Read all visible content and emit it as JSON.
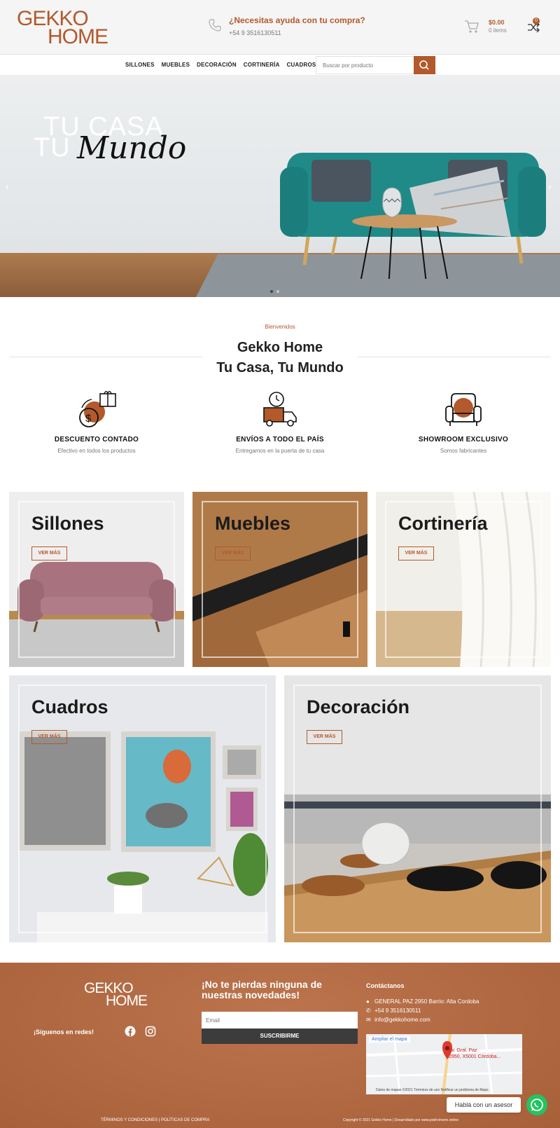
{
  "header": {
    "logo_line1": "GEKKO",
    "logo_line2": "HOME",
    "help_title": "¿Necesitas ayuda con tu compra?",
    "help_phone": "+54 9 3516130511",
    "cart_amount": "$0.00",
    "cart_items": "0 items",
    "compare_count": "0"
  },
  "nav": {
    "items": [
      "SILLONES",
      "MUEBLES",
      "DECORACIÓN",
      "CORTINERÍA",
      "CUADROS"
    ],
    "search_placeholder": "Buscar por producto"
  },
  "hero": {
    "line1": "TU CASA",
    "line2": "TU",
    "script": "Mundo",
    "slides": 2,
    "active_slide": 1
  },
  "welcome": {
    "eyebrow": "Bienvenidos",
    "title1": "Gekko Home",
    "title2": "Tu Casa, Tu Mundo",
    "features": [
      {
        "title": "DESCUENTO CONTADO",
        "subtitle": "Efectivo en todos los productos",
        "icon": "discount-icon"
      },
      {
        "title": "ENVÍOS A TODO EL PAÍS",
        "subtitle": "Entregamos en la puerta de tu casa",
        "icon": "delivery-icon"
      },
      {
        "title": "SHOWROOM EXCLUSIVO",
        "subtitle": "Somos fabricantes",
        "icon": "armchair-icon"
      }
    ]
  },
  "categories": [
    {
      "title": "Sillones",
      "button": "VER MÁS"
    },
    {
      "title": "Muebles",
      "button": "VER MÁS"
    },
    {
      "title": "Cortinería",
      "button": "VER MÁS"
    },
    {
      "title": "Cuadros",
      "button": "VER MÁS"
    },
    {
      "title": "Decoración",
      "button": "VER MÁS"
    }
  ],
  "footer": {
    "logo_line1": "GEKKO",
    "logo_line2": "HOME",
    "follow": "¡Síguenos en redes!",
    "news_title": "¡No te pierdas ninguna de nuestras novedades!",
    "email_placeholder": "Email",
    "subscribe": "SUSCRIBIRME",
    "contact_title": "Contáctanos",
    "address": "GENERAL PAZ 2950 Barrio: Alta Cordoba",
    "phone": "+54 9 3516130511",
    "mail": "info@gekkohome.com",
    "map_enlarge": "Ampliar el mapa",
    "map_pin_line1": "Av. Gral. Paz",
    "map_pin_line2": "2950, X5001 Córdoba...",
    "map_footer": "Datos de mapas ©2021   Términos de uso   Notificar un problema de Maps",
    "links": "TÉRMINOS Y CONDICIONES  |  POLÍTICAS DE COMPRA",
    "copyright": "Copyright © 2021 Gekko Home | Desarrollado por www.pedroinvero.online",
    "whatsapp_label": "Hablá con un asesor"
  },
  "colors": {
    "accent": "#b3592b",
    "footer": "#b6683e",
    "whatsapp": "#23c461"
  }
}
